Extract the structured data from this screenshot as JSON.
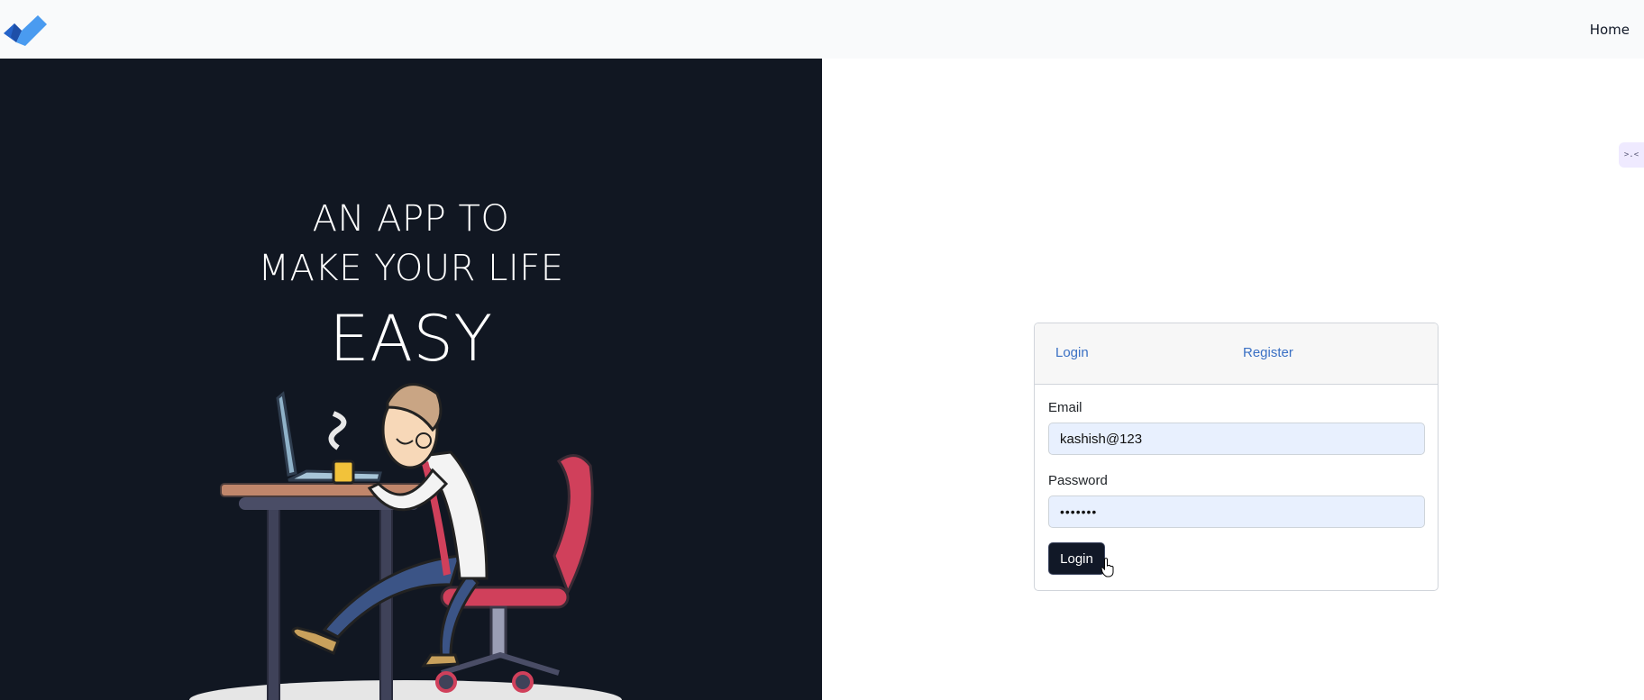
{
  "navbar": {
    "logo_icon": "checkmark-logo-icon",
    "home_label": "Home"
  },
  "hero": {
    "line1": "AN APP TO",
    "line2": "MAKE YOUR LIFE",
    "line3": "EASY",
    "illustration": "man-at-desk-with-laptop-illustration"
  },
  "login_card": {
    "tabs": [
      "Login",
      "Register"
    ],
    "email_label": "Email",
    "email_value": "kashish@123",
    "password_label": "Password",
    "password_value": "•••••••",
    "submit_label": "Login"
  },
  "colors": {
    "navbar_bg": "#f9fafb",
    "hero_bg": "#111722",
    "tab_link": "#3a70c4",
    "input_bg": "#e8f0fe",
    "button_bg": "#111827"
  }
}
